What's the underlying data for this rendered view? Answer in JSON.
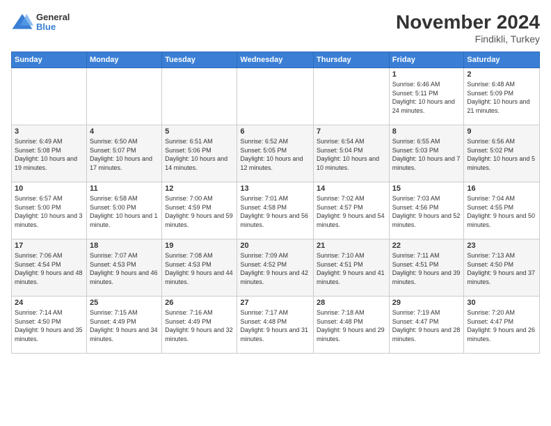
{
  "logo": {
    "general": "General",
    "blue": "Blue"
  },
  "header": {
    "month": "November 2024",
    "location": "Findikli, Turkey"
  },
  "weekdays": [
    "Sunday",
    "Monday",
    "Tuesday",
    "Wednesday",
    "Thursday",
    "Friday",
    "Saturday"
  ],
  "weeks": [
    [
      {
        "day": "",
        "info": ""
      },
      {
        "day": "",
        "info": ""
      },
      {
        "day": "",
        "info": ""
      },
      {
        "day": "",
        "info": ""
      },
      {
        "day": "",
        "info": ""
      },
      {
        "day": "1",
        "info": "Sunrise: 6:46 AM\nSunset: 5:11 PM\nDaylight: 10 hours and 24 minutes."
      },
      {
        "day": "2",
        "info": "Sunrise: 6:48 AM\nSunset: 5:09 PM\nDaylight: 10 hours and 21 minutes."
      }
    ],
    [
      {
        "day": "3",
        "info": "Sunrise: 6:49 AM\nSunset: 5:08 PM\nDaylight: 10 hours and 19 minutes."
      },
      {
        "day": "4",
        "info": "Sunrise: 6:50 AM\nSunset: 5:07 PM\nDaylight: 10 hours and 17 minutes."
      },
      {
        "day": "5",
        "info": "Sunrise: 6:51 AM\nSunset: 5:06 PM\nDaylight: 10 hours and 14 minutes."
      },
      {
        "day": "6",
        "info": "Sunrise: 6:52 AM\nSunset: 5:05 PM\nDaylight: 10 hours and 12 minutes."
      },
      {
        "day": "7",
        "info": "Sunrise: 6:54 AM\nSunset: 5:04 PM\nDaylight: 10 hours and 10 minutes."
      },
      {
        "day": "8",
        "info": "Sunrise: 6:55 AM\nSunset: 5:03 PM\nDaylight: 10 hours and 7 minutes."
      },
      {
        "day": "9",
        "info": "Sunrise: 6:56 AM\nSunset: 5:02 PM\nDaylight: 10 hours and 5 minutes."
      }
    ],
    [
      {
        "day": "10",
        "info": "Sunrise: 6:57 AM\nSunset: 5:00 PM\nDaylight: 10 hours and 3 minutes."
      },
      {
        "day": "11",
        "info": "Sunrise: 6:58 AM\nSunset: 5:00 PM\nDaylight: 10 hours and 1 minute."
      },
      {
        "day": "12",
        "info": "Sunrise: 7:00 AM\nSunset: 4:59 PM\nDaylight: 9 hours and 59 minutes."
      },
      {
        "day": "13",
        "info": "Sunrise: 7:01 AM\nSunset: 4:58 PM\nDaylight: 9 hours and 56 minutes."
      },
      {
        "day": "14",
        "info": "Sunrise: 7:02 AM\nSunset: 4:57 PM\nDaylight: 9 hours and 54 minutes."
      },
      {
        "day": "15",
        "info": "Sunrise: 7:03 AM\nSunset: 4:56 PM\nDaylight: 9 hours and 52 minutes."
      },
      {
        "day": "16",
        "info": "Sunrise: 7:04 AM\nSunset: 4:55 PM\nDaylight: 9 hours and 50 minutes."
      }
    ],
    [
      {
        "day": "17",
        "info": "Sunrise: 7:06 AM\nSunset: 4:54 PM\nDaylight: 9 hours and 48 minutes."
      },
      {
        "day": "18",
        "info": "Sunrise: 7:07 AM\nSunset: 4:53 PM\nDaylight: 9 hours and 46 minutes."
      },
      {
        "day": "19",
        "info": "Sunrise: 7:08 AM\nSunset: 4:53 PM\nDaylight: 9 hours and 44 minutes."
      },
      {
        "day": "20",
        "info": "Sunrise: 7:09 AM\nSunset: 4:52 PM\nDaylight: 9 hours and 42 minutes."
      },
      {
        "day": "21",
        "info": "Sunrise: 7:10 AM\nSunset: 4:51 PM\nDaylight: 9 hours and 41 minutes."
      },
      {
        "day": "22",
        "info": "Sunrise: 7:11 AM\nSunset: 4:51 PM\nDaylight: 9 hours and 39 minutes."
      },
      {
        "day": "23",
        "info": "Sunrise: 7:13 AM\nSunset: 4:50 PM\nDaylight: 9 hours and 37 minutes."
      }
    ],
    [
      {
        "day": "24",
        "info": "Sunrise: 7:14 AM\nSunset: 4:50 PM\nDaylight: 9 hours and 35 minutes."
      },
      {
        "day": "25",
        "info": "Sunrise: 7:15 AM\nSunset: 4:49 PM\nDaylight: 9 hours and 34 minutes."
      },
      {
        "day": "26",
        "info": "Sunrise: 7:16 AM\nSunset: 4:49 PM\nDaylight: 9 hours and 32 minutes."
      },
      {
        "day": "27",
        "info": "Sunrise: 7:17 AM\nSunset: 4:48 PM\nDaylight: 9 hours and 31 minutes."
      },
      {
        "day": "28",
        "info": "Sunrise: 7:18 AM\nSunset: 4:48 PM\nDaylight: 9 hours and 29 minutes."
      },
      {
        "day": "29",
        "info": "Sunrise: 7:19 AM\nSunset: 4:47 PM\nDaylight: 9 hours and 28 minutes."
      },
      {
        "day": "30",
        "info": "Sunrise: 7:20 AM\nSunset: 4:47 PM\nDaylight: 9 hours and 26 minutes."
      }
    ]
  ]
}
